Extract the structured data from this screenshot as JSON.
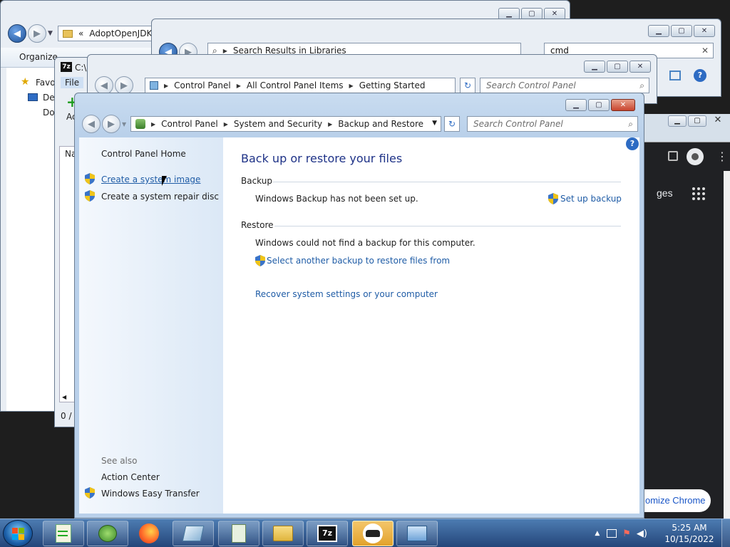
{
  "bg_explorer": {
    "address_folder": "AdoptOpenJDK",
    "toolbar_organize": "Organize",
    "nav_items": [
      "Favo",
      "Des",
      "Doc"
    ],
    "col_header": "Na",
    "status": "0 / 0"
  },
  "bg_search_window": {
    "address_text": "Search Results in Libraries",
    "search_value": "cmd"
  },
  "bg_7zip": {
    "title": "C:\\",
    "menu_file": "File",
    "toolbar_label": "Ac"
  },
  "bg_getting_started": {
    "breadcrumb": [
      "Control Panel",
      "All Control Panel Items",
      "Getting Started"
    ],
    "search_placeholder": "Search Control Panel"
  },
  "bg_chrome": {
    "apps_text": "ges",
    "customize_button": "omize Chrome"
  },
  "main_window": {
    "breadcrumb": [
      "Control Panel",
      "System and Security",
      "Backup and Restore"
    ],
    "search_placeholder": "Search Control Panel",
    "sidebar": {
      "home_link": "Control Panel Home",
      "tasks": [
        "Create a system image",
        "Create a system repair disc"
      ],
      "see_also_label": "See also",
      "see_also": [
        "Action Center",
        "Windows Easy Transfer"
      ]
    },
    "content": {
      "heading": "Back up or restore your files",
      "backup_section": "Backup",
      "backup_status": "Windows Backup has not been set up.",
      "setup_link": "Set up backup",
      "restore_section": "Restore",
      "restore_status": "Windows could not find a backup for this computer.",
      "select_backup_link": "Select another backup to restore files from",
      "recover_link": "Recover system settings or your computer"
    }
  },
  "taskbar": {
    "items": [
      "notepad-app",
      "gecko-app",
      "firefox-browser",
      "pen-app",
      "document-app",
      "file-explorer",
      "7zip-app",
      "incognito-browser",
      "control-panel-app"
    ],
    "time": "5:25 AM",
    "date": "10/15/2022"
  },
  "colors": {
    "link": "#1f5ca6",
    "heading": "#1e3287",
    "sidebar_bg": "#e3eefa",
    "taskbar": "#24467a"
  }
}
